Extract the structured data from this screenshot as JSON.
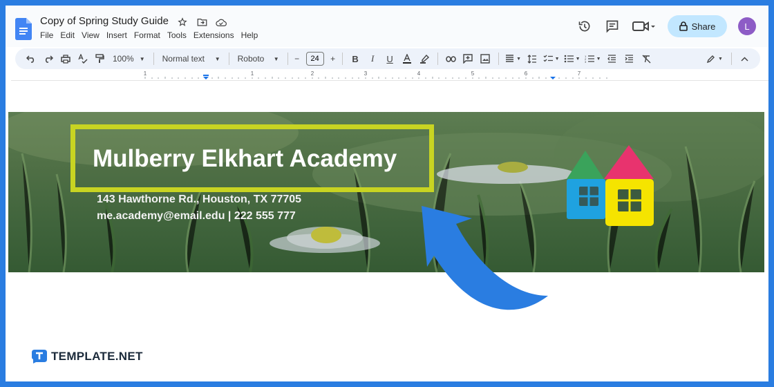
{
  "document": {
    "title": "Copy of Spring Study Guide",
    "icon": "google-docs-icon"
  },
  "menu": [
    "File",
    "Edit",
    "View",
    "Insert",
    "Format",
    "Tools",
    "Extensions",
    "Help"
  ],
  "actions": {
    "share_label": "Share",
    "avatar_initial": "L"
  },
  "toolbar": {
    "zoom": "100%",
    "style": "Normal text",
    "font": "Roboto",
    "font_size": "24"
  },
  "ruler": {
    "numbers": [
      "1",
      "1",
      "2",
      "3",
      "4",
      "5",
      "6",
      "7"
    ]
  },
  "banner": {
    "school_name": "Mulberry Elkhart Academy",
    "address": "143 Hawthorne Rd., Houston, TX 77705",
    "contact": "me.academy@email.edu | 222 555 777",
    "highlight_color": "#c8d422",
    "logo_colors": [
      "#3aa35b",
      "#e8336e",
      "#1fa2e0",
      "#f5e400"
    ]
  },
  "annotation": {
    "arrow_color": "#2a7de1"
  },
  "watermark": {
    "brand": "TEMPLATE.NET"
  }
}
